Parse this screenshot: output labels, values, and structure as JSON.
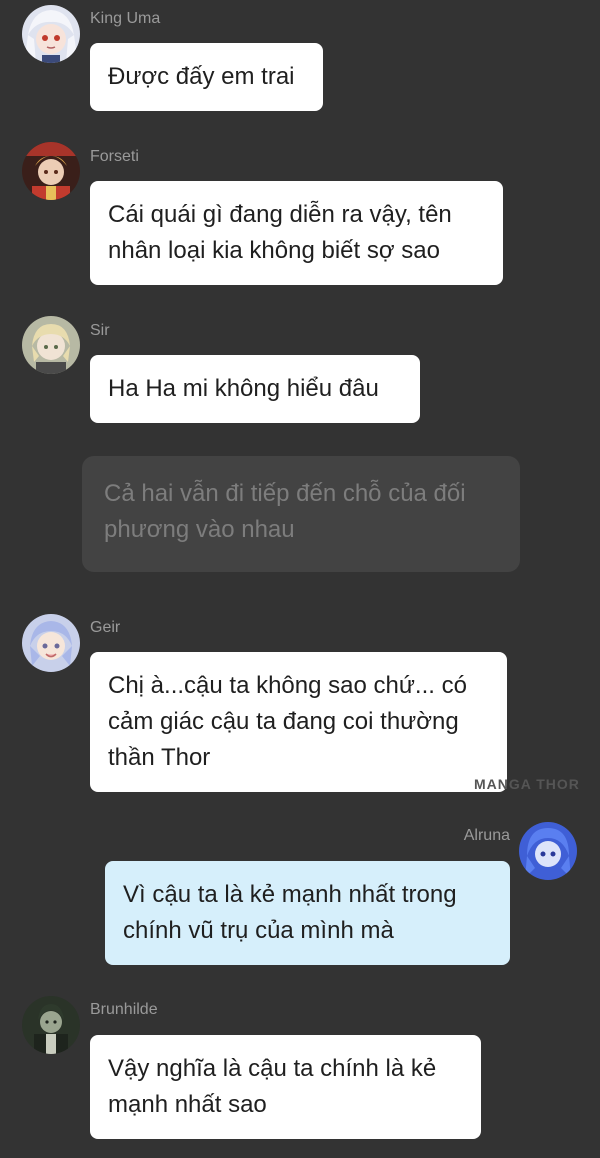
{
  "messages": [
    {
      "sender": "King Uma",
      "text": "Được đấy em trai",
      "avatar_icon": "king-uma-avatar-icon"
    },
    {
      "sender": "Forseti",
      "text": "Cái quái gì đang diễn ra vậy, tên nhân loại kia không biết sợ sao",
      "avatar_icon": "forseti-avatar-icon"
    },
    {
      "sender": "Sir",
      "text": "Ha Ha mi không hiểu đâu",
      "avatar_icon": "sir-avatar-icon"
    },
    {
      "narration": "Cả hai vẫn đi tiếp đến chỗ của đối phương vào nhau"
    },
    {
      "sender": "Geir",
      "text": "Chị à...cậu ta không sao chứ... có cảm giác cậu ta đang coi thường thần Thor",
      "avatar_icon": "geir-avatar-icon"
    },
    {
      "sender": "Alruna",
      "text": "Vì cậu ta là kẻ mạnh nhất trong chính vũ trụ của mình mà",
      "avatar_icon": "alruna-avatar-icon",
      "own": true
    },
    {
      "sender": "Brunhilde",
      "text": "Vậy nghĩa là cậu ta chính là kẻ mạnh nhất sao",
      "avatar_icon": "brunhilde-avatar-icon"
    }
  ],
  "watermark": "MANGA THOR",
  "colors": {
    "background": "#333333",
    "bubble": "#ffffff",
    "own_bubble": "#d6effb",
    "narration_bg": "#434343",
    "narration_text": "#7d7d7d",
    "name_text": "#9a9a9a"
  }
}
